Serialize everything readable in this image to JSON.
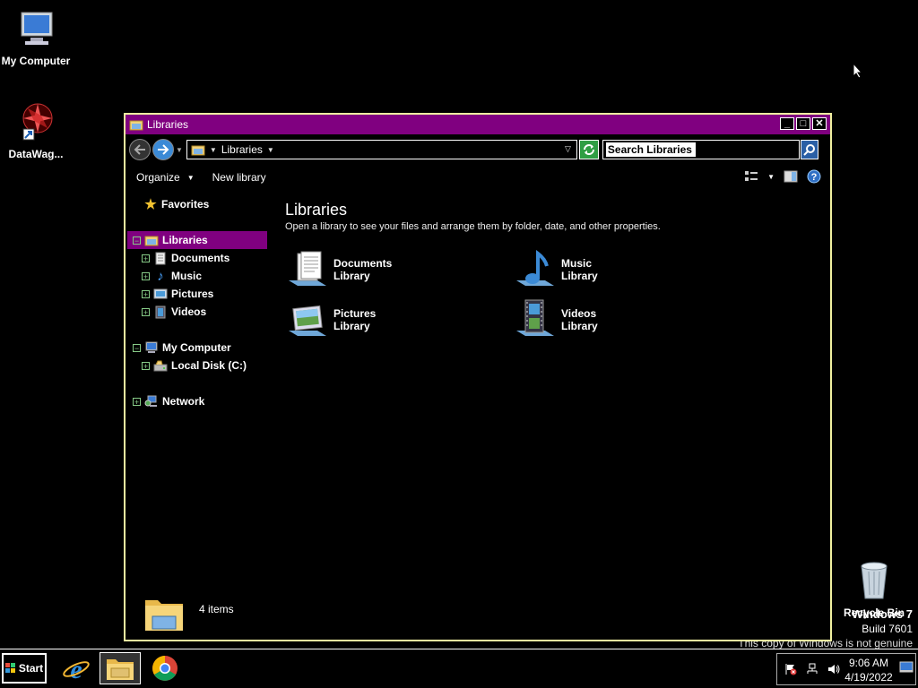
{
  "desktop": {
    "icons": [
      {
        "label": "My Computer"
      },
      {
        "label": "DataWag..."
      },
      {
        "label": "Recycle Bin"
      }
    ],
    "watermark": {
      "title": "Windows 7",
      "build": "Build 7601",
      "notice": "This copy of Windows is not genuine"
    }
  },
  "window": {
    "title": "Libraries",
    "address": {
      "crumb": "Libraries"
    },
    "search": {
      "value": "Search Libraries"
    },
    "toolbar": {
      "organize": "Organize",
      "new_library": "New library"
    },
    "nav": {
      "favorites": "Favorites",
      "libraries": "Libraries",
      "documents": "Documents",
      "music": "Music",
      "pictures": "Pictures",
      "videos": "Videos",
      "my_computer": "My Computer",
      "local_disk": "Local Disk (C:)",
      "network": "Network"
    },
    "content": {
      "title": "Libraries",
      "description": "Open a library to see your files and arrange them by folder, date, and other properties.",
      "items": [
        {
          "name": "Documents",
          "type": "Library"
        },
        {
          "name": "Music",
          "type": "Library"
        },
        {
          "name": "Pictures",
          "type": "Library"
        },
        {
          "name": "Videos",
          "type": "Library"
        }
      ]
    },
    "details": {
      "count": "4 items"
    }
  },
  "taskbar": {
    "start": "Start",
    "apps": [
      "internet-explorer",
      "windows-explorer",
      "chrome"
    ],
    "clock": {
      "time": "9:06 AM",
      "date": "4/19/2022"
    }
  },
  "colors": {
    "titlebar": "#800080",
    "selection": "#800080",
    "window_border": "#f0f0a0"
  }
}
